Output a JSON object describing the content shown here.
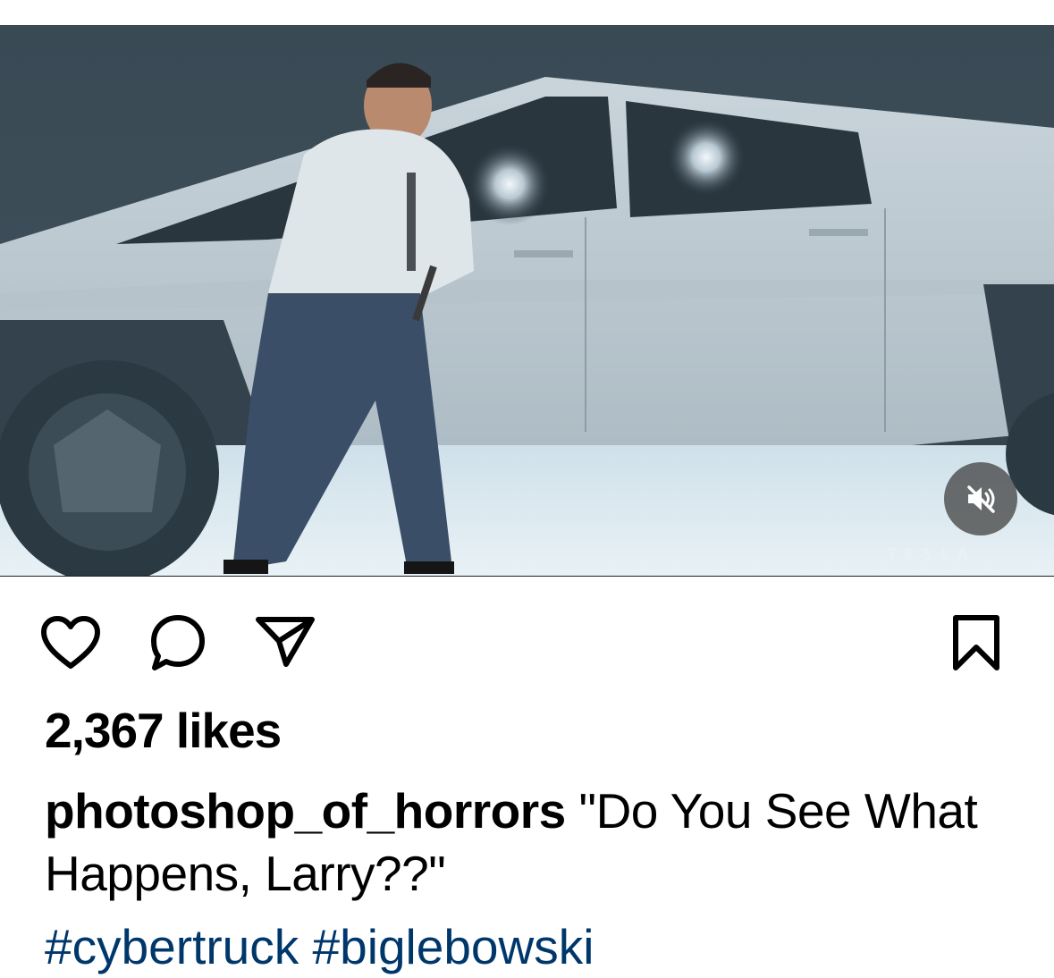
{
  "post": {
    "media": {
      "watermark": "TESLA",
      "mute_button_label": "Unmute"
    },
    "actions": {
      "like_label": "Like",
      "comment_label": "Comment",
      "share_label": "Share",
      "save_label": "Save"
    },
    "likes": "2,367 likes",
    "caption": {
      "username": "photoshop_of_horrors",
      "text": "\"Do You See What Happens, Larry??\""
    },
    "hashtags": [
      "#cybertruck",
      "#biglebowski"
    ]
  },
  "icons": {
    "like": "heart-outline-icon",
    "comment": "speech-bubble-icon",
    "share": "paper-plane-icon",
    "save": "bookmark-outline-icon",
    "mute": "speaker-muted-icon"
  },
  "colors": {
    "background": "#ffffff",
    "text": "#000000",
    "hashtag": "#00376b",
    "icon_stroke": "#000000"
  }
}
